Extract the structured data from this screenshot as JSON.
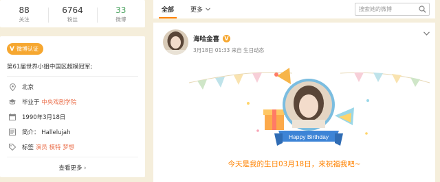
{
  "stats": [
    {
      "value": "88",
      "label": "关注"
    },
    {
      "value": "6764",
      "label": "粉丝"
    },
    {
      "value": "33",
      "label": "微博"
    }
  ],
  "profile": {
    "badge_label": "微博认证",
    "verify_text": "第61届世界小姐中国区超模冠军;",
    "location": "北京",
    "school_prefix": "毕业于",
    "school": "中央戏剧学院",
    "birthday": "1990年3月18日",
    "intro_prefix": "简介：",
    "intro": "Hallelujah",
    "tags_prefix": "标签",
    "tags": [
      "演员",
      "模特",
      "梦想"
    ],
    "more_label": "查看更多"
  },
  "tabs": {
    "all": "全部",
    "more": "更多"
  },
  "search": {
    "placeholder": "搜索她的微博"
  },
  "post": {
    "author": "海哈金喜",
    "time": "3月18日 01:33",
    "source": "来自 生日动态",
    "banner_text": "Happy Birthday",
    "body": "今天是我的生日03月18日，来祝福我吧~"
  },
  "colors": {
    "accent": "#ff8200",
    "badge": "#f6a730",
    "link": "#eb7350",
    "green": "#46a05c",
    "background": "#f5eedb"
  }
}
